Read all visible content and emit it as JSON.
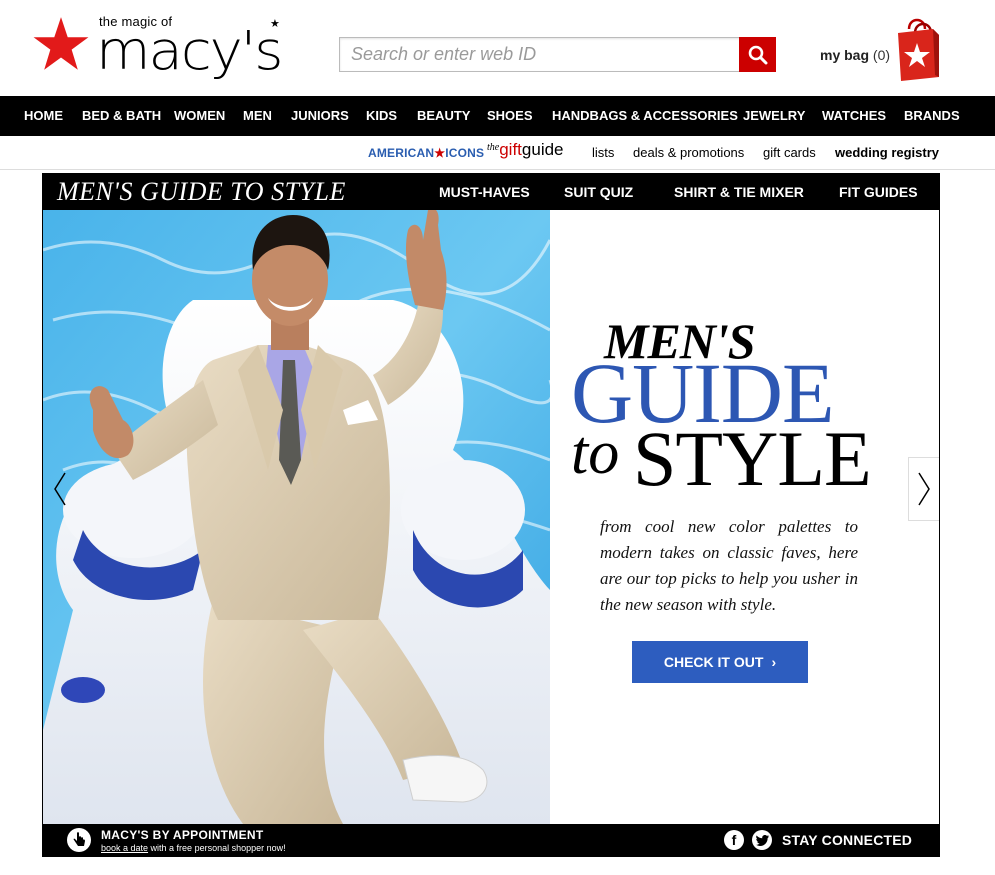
{
  "header": {
    "logo_tagline": "the magic of",
    "logo_wordmark": "macy's",
    "search_placeholder": "Search or enter web ID",
    "bag_label": "my bag",
    "bag_count": "(0)"
  },
  "main_nav": [
    "HOME",
    "BED & BATH",
    "WOMEN",
    "MEN",
    "JUNIORS",
    "KIDS",
    "BEAUTY",
    "SHOES",
    "HANDBAGS & ACCESSORIES",
    "JEWELRY",
    "WATCHES",
    "BRANDS"
  ],
  "sub_nav": {
    "american_icons_a": "AMERICAN",
    "american_icons_b": "ICONS",
    "gift_the": "the",
    "gift_word": "gift",
    "gift_guide": "guide",
    "lists": "lists",
    "deals": "deals & promotions",
    "gift_cards": "gift cards",
    "wedding": "wedding registry"
  },
  "promo": {
    "bar_title": "MEN'S GUIDE TO STYLE",
    "tabs": [
      "MUST-HAVES",
      "SUIT QUIZ",
      "SHIRT & TIE MIXER",
      "FIT GUIDES"
    ],
    "headline_1": "MEN'S",
    "headline_2": "GUIDE",
    "headline_3a": "to",
    "headline_3b": "STYLE",
    "blurb": "from cool new color palettes to modern takes on classic faves, here are our top picks to help you usher in the new season with style.",
    "cta": "CHECK IT OUT",
    "cta_chevron": "›"
  },
  "footer": {
    "appt_title": "MACY'S BY APPOINTMENT",
    "appt_link": "book a date",
    "appt_rest": " with a free personal shopper now!",
    "stay_connected": "STAY CONNECTED"
  },
  "colors": {
    "brand_red": "#cc0000",
    "cta_blue": "#2d5dbf",
    "headline_blue": "#2d57b3",
    "nav_bg": "#000000"
  },
  "icons": [
    "macys-star-icon",
    "search-icon",
    "shopping-bag-icon",
    "chevron-left-icon",
    "chevron-right-icon",
    "hand-pointer-icon",
    "facebook-icon",
    "twitter-icon"
  ]
}
